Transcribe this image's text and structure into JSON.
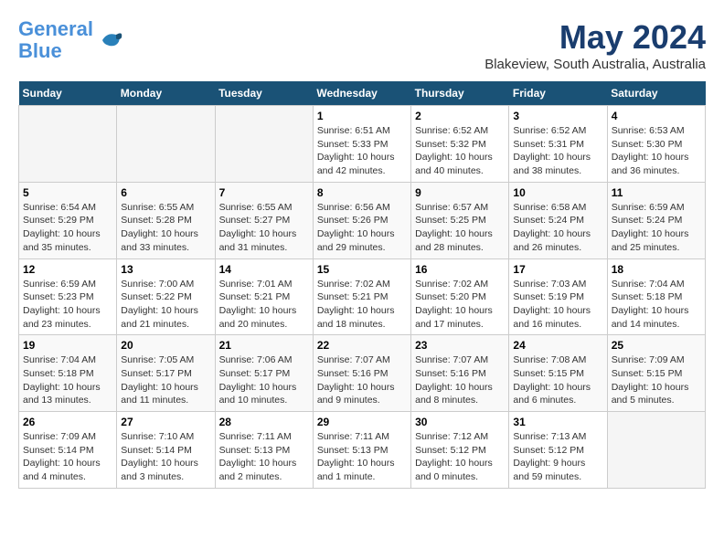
{
  "header": {
    "logo_line1": "General",
    "logo_line2": "Blue",
    "title": "May 2024",
    "subtitle": "Blakeview, South Australia, Australia"
  },
  "columns": [
    "Sunday",
    "Monday",
    "Tuesday",
    "Wednesday",
    "Thursday",
    "Friday",
    "Saturday"
  ],
  "weeks": [
    [
      {
        "day": "",
        "info": ""
      },
      {
        "day": "",
        "info": ""
      },
      {
        "day": "",
        "info": ""
      },
      {
        "day": "1",
        "info": "Sunrise: 6:51 AM\nSunset: 5:33 PM\nDaylight: 10 hours\nand 42 minutes."
      },
      {
        "day": "2",
        "info": "Sunrise: 6:52 AM\nSunset: 5:32 PM\nDaylight: 10 hours\nand 40 minutes."
      },
      {
        "day": "3",
        "info": "Sunrise: 6:52 AM\nSunset: 5:31 PM\nDaylight: 10 hours\nand 38 minutes."
      },
      {
        "day": "4",
        "info": "Sunrise: 6:53 AM\nSunset: 5:30 PM\nDaylight: 10 hours\nand 36 minutes."
      }
    ],
    [
      {
        "day": "5",
        "info": "Sunrise: 6:54 AM\nSunset: 5:29 PM\nDaylight: 10 hours\nand 35 minutes."
      },
      {
        "day": "6",
        "info": "Sunrise: 6:55 AM\nSunset: 5:28 PM\nDaylight: 10 hours\nand 33 minutes."
      },
      {
        "day": "7",
        "info": "Sunrise: 6:55 AM\nSunset: 5:27 PM\nDaylight: 10 hours\nand 31 minutes."
      },
      {
        "day": "8",
        "info": "Sunrise: 6:56 AM\nSunset: 5:26 PM\nDaylight: 10 hours\nand 29 minutes."
      },
      {
        "day": "9",
        "info": "Sunrise: 6:57 AM\nSunset: 5:25 PM\nDaylight: 10 hours\nand 28 minutes."
      },
      {
        "day": "10",
        "info": "Sunrise: 6:58 AM\nSunset: 5:24 PM\nDaylight: 10 hours\nand 26 minutes."
      },
      {
        "day": "11",
        "info": "Sunrise: 6:59 AM\nSunset: 5:24 PM\nDaylight: 10 hours\nand 25 minutes."
      }
    ],
    [
      {
        "day": "12",
        "info": "Sunrise: 6:59 AM\nSunset: 5:23 PM\nDaylight: 10 hours\nand 23 minutes."
      },
      {
        "day": "13",
        "info": "Sunrise: 7:00 AM\nSunset: 5:22 PM\nDaylight: 10 hours\nand 21 minutes."
      },
      {
        "day": "14",
        "info": "Sunrise: 7:01 AM\nSunset: 5:21 PM\nDaylight: 10 hours\nand 20 minutes."
      },
      {
        "day": "15",
        "info": "Sunrise: 7:02 AM\nSunset: 5:21 PM\nDaylight: 10 hours\nand 18 minutes."
      },
      {
        "day": "16",
        "info": "Sunrise: 7:02 AM\nSunset: 5:20 PM\nDaylight: 10 hours\nand 17 minutes."
      },
      {
        "day": "17",
        "info": "Sunrise: 7:03 AM\nSunset: 5:19 PM\nDaylight: 10 hours\nand 16 minutes."
      },
      {
        "day": "18",
        "info": "Sunrise: 7:04 AM\nSunset: 5:18 PM\nDaylight: 10 hours\nand 14 minutes."
      }
    ],
    [
      {
        "day": "19",
        "info": "Sunrise: 7:04 AM\nSunset: 5:18 PM\nDaylight: 10 hours\nand 13 minutes."
      },
      {
        "day": "20",
        "info": "Sunrise: 7:05 AM\nSunset: 5:17 PM\nDaylight: 10 hours\nand 11 minutes."
      },
      {
        "day": "21",
        "info": "Sunrise: 7:06 AM\nSunset: 5:17 PM\nDaylight: 10 hours\nand 10 minutes."
      },
      {
        "day": "22",
        "info": "Sunrise: 7:07 AM\nSunset: 5:16 PM\nDaylight: 10 hours\nand 9 minutes."
      },
      {
        "day": "23",
        "info": "Sunrise: 7:07 AM\nSunset: 5:16 PM\nDaylight: 10 hours\nand 8 minutes."
      },
      {
        "day": "24",
        "info": "Sunrise: 7:08 AM\nSunset: 5:15 PM\nDaylight: 10 hours\nand 6 minutes."
      },
      {
        "day": "25",
        "info": "Sunrise: 7:09 AM\nSunset: 5:15 PM\nDaylight: 10 hours\nand 5 minutes."
      }
    ],
    [
      {
        "day": "26",
        "info": "Sunrise: 7:09 AM\nSunset: 5:14 PM\nDaylight: 10 hours\nand 4 minutes."
      },
      {
        "day": "27",
        "info": "Sunrise: 7:10 AM\nSunset: 5:14 PM\nDaylight: 10 hours\nand 3 minutes."
      },
      {
        "day": "28",
        "info": "Sunrise: 7:11 AM\nSunset: 5:13 PM\nDaylight: 10 hours\nand 2 minutes."
      },
      {
        "day": "29",
        "info": "Sunrise: 7:11 AM\nSunset: 5:13 PM\nDaylight: 10 hours\nand 1 minute."
      },
      {
        "day": "30",
        "info": "Sunrise: 7:12 AM\nSunset: 5:12 PM\nDaylight: 10 hours\nand 0 minutes."
      },
      {
        "day": "31",
        "info": "Sunrise: 7:13 AM\nSunset: 5:12 PM\nDaylight: 9 hours\nand 59 minutes."
      },
      {
        "day": "",
        "info": ""
      }
    ]
  ]
}
